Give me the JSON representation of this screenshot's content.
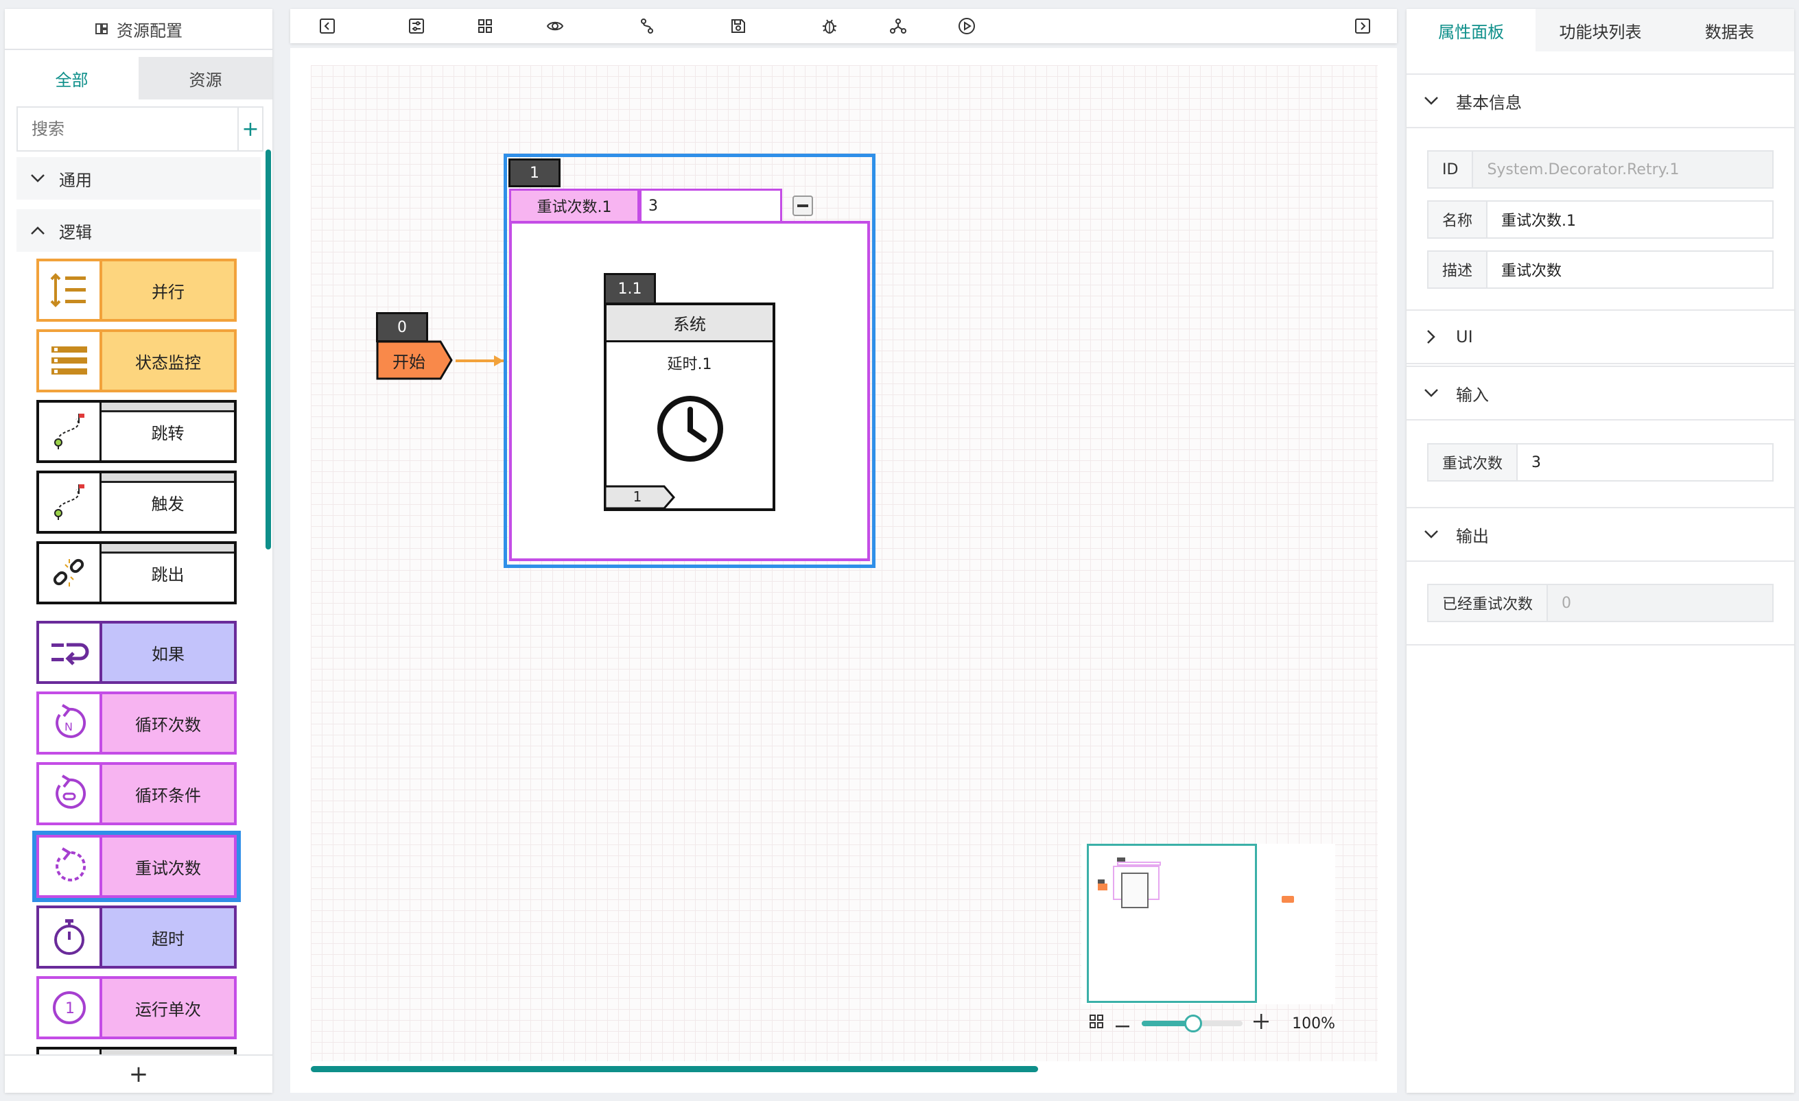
{
  "left": {
    "title": "资源配置",
    "tabs": [
      "全部",
      "资源"
    ],
    "search_placeholder": "搜索",
    "add_symbol": "+",
    "categories": [
      "通用",
      "逻辑"
    ],
    "blocks": [
      {
        "label": "并行",
        "fill": "#fdd57e",
        "border": "#f2a23b"
      },
      {
        "label": "状态监控",
        "fill": "#fdd57e",
        "border": "#f2a23b"
      },
      {
        "label": "跳转",
        "fill": "#ffffff",
        "border": "#111111"
      },
      {
        "label": "触发",
        "fill": "#ffffff",
        "border": "#111111"
      },
      {
        "label": "跳出",
        "fill": "#ffffff",
        "border": "#111111"
      },
      {
        "label": "如果",
        "fill": "#c3c3fb",
        "border": "#6a2b9a"
      },
      {
        "label": "循环次数",
        "fill": "#f7b4f1",
        "border": "#c44de6"
      },
      {
        "label": "循环条件",
        "fill": "#f7b4f1",
        "border": "#c44de6"
      },
      {
        "label": "重试次数",
        "fill": "#f7b4f1",
        "border": "#c44de6"
      },
      {
        "label": "超时",
        "fill": "#c3c3fb",
        "border": "#6a2b9a"
      },
      {
        "label": "运行单次",
        "fill": "#f7b4f1",
        "border": "#c44de6"
      }
    ],
    "bottom_add": "+"
  },
  "canvas": {
    "start": {
      "id": "0",
      "label": "开始"
    },
    "retry": {
      "id": "1",
      "name": "重试次数.1",
      "value": "3"
    },
    "system": {
      "id": "1.1",
      "title": "系统",
      "subtitle": "延时.1",
      "port": "1"
    },
    "zoom": "100%"
  },
  "right": {
    "tabs": [
      "属性面板",
      "功能块列表",
      "数据表"
    ],
    "sections": {
      "basic": "基本信息",
      "ui": "UI",
      "input": "输入",
      "output": "输出"
    },
    "fields": {
      "id_key": "ID",
      "id_val": "System.Decorator.Retry.1",
      "name_key": "名称",
      "name_val": "重试次数.1",
      "desc_key": "描述",
      "desc_val": "重试次数",
      "retry_key": "重试次数",
      "retry_val": "3",
      "done_key": "已经重试次数",
      "done_val": "0"
    }
  },
  "colors": {
    "accent": "#0e8f8a",
    "selection": "#2f8fe8",
    "start": "#f9894a"
  }
}
